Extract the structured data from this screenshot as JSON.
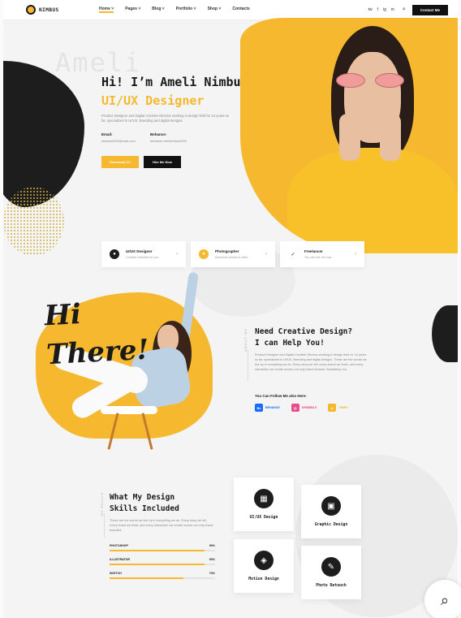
{
  "header": {
    "logo": "NIMBUS",
    "nav": [
      "Home",
      "Pages",
      "Blog",
      "Portfolio",
      "Shop",
      "Contacts"
    ],
    "social": [
      "tw",
      "f",
      "ig",
      "in"
    ],
    "contact_label": "Contact Me",
    "search_glyph": "⌕",
    "chevron": "˅"
  },
  "hero": {
    "watermark": "Ameli",
    "title": "Hi! I’m Ameli Nimbus -",
    "role": "UI/UX Designer",
    "description": "Product Designer and Digital Creative Director working in design field for 13 years so far, specialized in UI/UX, Branding and digital designs.",
    "email_label": "Email:",
    "email_value": "nimbus2000@mail.com",
    "behance_label": "Behance:",
    "behance_value": "behance.net/nimbus2000",
    "download_label": "Download CV",
    "hire_label": "Hire Me Now"
  },
  "services": [
    {
      "title": "UI/UX Designer",
      "sub": "Creative websites for you",
      "icon": "●"
    },
    {
      "title": "Photographer",
      "sub": "Awesome photos & video",
      "icon": "●"
    },
    {
      "title": "Freelancer",
      "sub": "You can hire me now",
      "icon": "✓"
    }
  ],
  "about": {
    "hi": "Hi",
    "there": "There!",
    "vertical": "ABOUT ME",
    "heading_1": "Need Creative Design?",
    "heading_2": "I can Help You!",
    "text": "Product Designer and Digital Creative Director working in design field for 13 years so far, specialized in UI/UX, Branding and digital designs. These are the words we live by in everything we do. Every story we tell, every brand we build, and every interaction we create moves not only brand forward. Beautifully, too.",
    "follow_label": "You Can Follow Me also Here:",
    "follow": [
      {
        "name": "BEHANCE",
        "glyph": "Be",
        "color": "#1769ff"
      },
      {
        "name": "DRIBBBLE",
        "glyph": "◎",
        "color": "#ea4c89"
      },
      {
        "name": "VIMEO",
        "glyph": "▸",
        "color": "#f5b82e"
      }
    ],
    "arrow": "›"
  },
  "skills": {
    "vertical": "MY SKILLS",
    "heading_1": "What My Design",
    "heading_2": "Skills Included",
    "text": "These are the words we live by in everything we do. Every story we tell, every brand we build, and every interaction we create moves not only brand beautiful.",
    "items": [
      {
        "name": "PHOTOSHOP",
        "value": "90%",
        "level": 0.9
      },
      {
        "name": "ILLUSTRATOR",
        "value": "90%",
        "level": 0.9
      },
      {
        "name": "SKETCH",
        "value": "70%",
        "level": 0.7
      }
    ]
  },
  "cards": [
    {
      "label": "UI/UX Design",
      "icon": "▦"
    },
    {
      "label": "Graphic Design",
      "icon": "▣"
    },
    {
      "label": "Motion Design",
      "icon": "◈"
    },
    {
      "label": "Photo Retouch",
      "icon": "✎"
    }
  ],
  "zoom_glyph": "⌕",
  "colors": {
    "accent": "#f5b82e",
    "dark": "#1d1d1d"
  }
}
